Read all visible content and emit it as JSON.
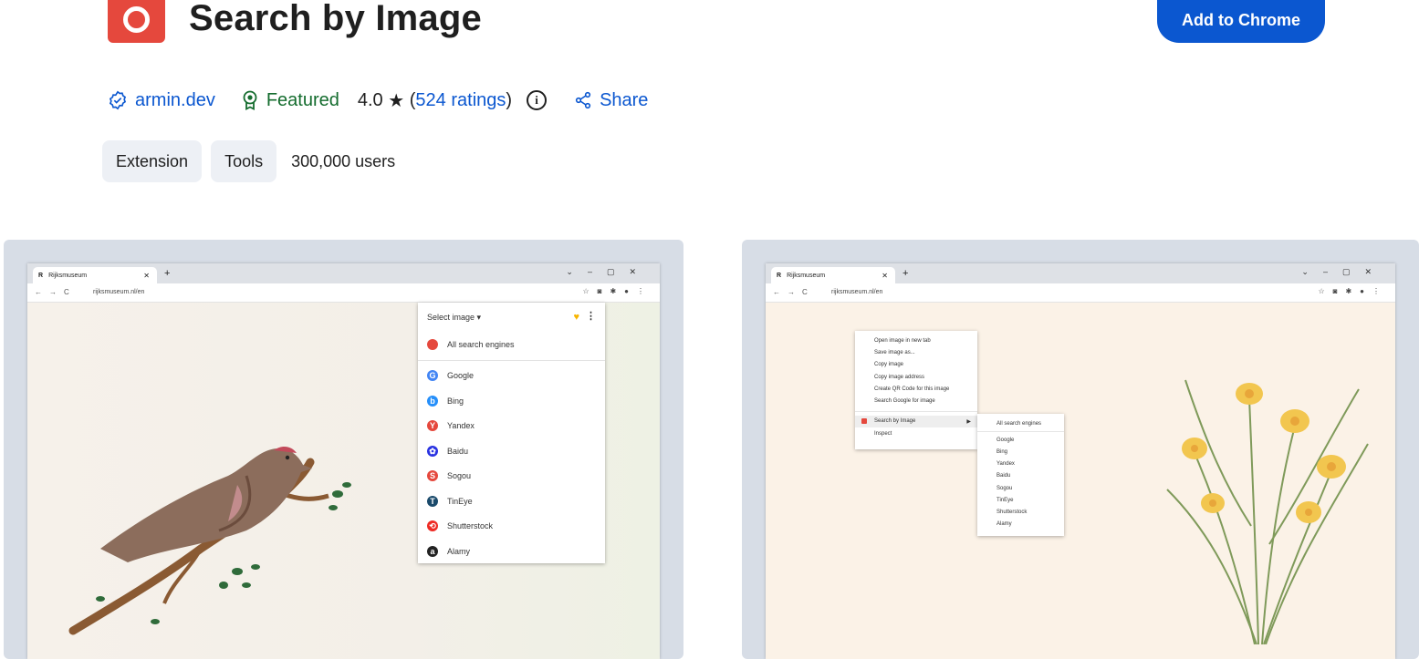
{
  "header": {
    "title": "Search by Image",
    "add_button": "Add to Chrome"
  },
  "meta": {
    "developer": "armin.dev",
    "featured": "Featured",
    "rating_value": "4.0",
    "rating_star": "★",
    "rating_open": "(",
    "ratings_link": "524 ratings",
    "rating_close": ")",
    "share": "Share"
  },
  "chips": {
    "items": [
      {
        "label": "Extension"
      },
      {
        "label": "Tools"
      }
    ],
    "users": "300,000 users"
  },
  "screenshots": [
    {
      "tab_title": "Rijksmuseum",
      "url": "rijksmuseum.nl/en",
      "popup": {
        "select_label": "Select image ▾",
        "all_engines": "All search engines",
        "engines": [
          {
            "name": "Google",
            "color": "#4285f4",
            "glyph": "G"
          },
          {
            "name": "Bing",
            "color": "#258ffa",
            "glyph": "b"
          },
          {
            "name": "Yandex",
            "color": "#e5483d",
            "glyph": "Y"
          },
          {
            "name": "Baidu",
            "color": "#2932e1",
            "glyph": "✿"
          },
          {
            "name": "Sogou",
            "color": "#e5483d",
            "glyph": "S"
          },
          {
            "name": "TinEye",
            "color": "#1a4a6b",
            "glyph": "T"
          },
          {
            "name": "Shutterstock",
            "color": "#ee2b24",
            "glyph": "⟲"
          },
          {
            "name": "Alamy",
            "color": "#222222",
            "glyph": "a"
          }
        ]
      }
    },
    {
      "tab_title": "Rijksmuseum",
      "url": "rijksmuseum.nl/en",
      "context_menu": [
        "Open image in new tab",
        "Save image as...",
        "Copy image",
        "Copy image address",
        "Create QR Code for this image",
        "Search Google for image"
      ],
      "context_selected": "Search by Image",
      "context_inspect": "Inspect",
      "submenu": {
        "all_engines": "All search engines",
        "engines": [
          "Google",
          "Bing",
          "Yandex",
          "Baidu",
          "Sogou",
          "TinEye",
          "Shutterstock",
          "Alamy"
        ]
      }
    }
  ],
  "colors": {
    "brand_red": "#e5483d",
    "primary_blue": "#0b57d0",
    "featured_green": "#146c2e"
  }
}
